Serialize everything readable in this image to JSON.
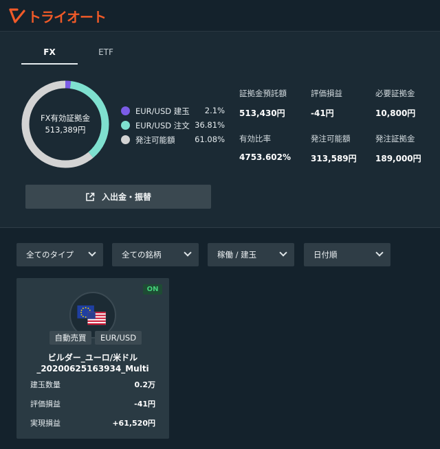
{
  "app": {
    "logo_text": "トライオート"
  },
  "tabs": [
    {
      "label": "FX",
      "active": true
    },
    {
      "label": "ETF",
      "active": false
    }
  ],
  "donut": {
    "center_title": "FX有効証拠金",
    "center_value": "513,389円",
    "segments": [
      {
        "name": "EUR/USD 建玉",
        "pct_label": "2.1%",
        "value": 2.1,
        "color": "#7b5ce6"
      },
      {
        "name": "EUR/USD 注文",
        "pct_label": "36.81%",
        "value": 36.81,
        "color": "#7fe0cf"
      },
      {
        "name": "発注可能額",
        "pct_label": "61.08%",
        "value": 61.08,
        "color": "#d3d3d3"
      }
    ]
  },
  "stats": [
    {
      "label": "証拠金預託額",
      "value": "513,430円"
    },
    {
      "label": "評価損益",
      "value": "-41円"
    },
    {
      "label": "必要証拠金",
      "value": "10,800円"
    },
    {
      "label": "有効比率",
      "value": "4753.602%"
    },
    {
      "label": "発注可能額",
      "value": "313,589円"
    },
    {
      "label": "発注証拠金",
      "value": "189,000円"
    }
  ],
  "deposit_button": {
    "label": "入出金・振替"
  },
  "filters": [
    {
      "label": "全てのタイプ"
    },
    {
      "label": "全ての銘柄"
    },
    {
      "label": "稼働 / 建玉"
    },
    {
      "label": "日付順"
    }
  ],
  "card": {
    "status": "ON",
    "status_color": "#44d07a",
    "tags": [
      "自動売買",
      "EUR/USD"
    ],
    "title_line1": "ビルダー_ユーロ/米ドル",
    "title_line2": "_20200625163934_Multi",
    "rows": [
      {
        "key": "建玉数量",
        "value": "0.2万"
      },
      {
        "key": "評価損益",
        "value": "-41円"
      },
      {
        "key": "実現損益",
        "value": "+61,520円"
      }
    ]
  },
  "colors": {
    "accent": "#f05a28",
    "background": "#14222c",
    "panel": "#1b2a34"
  }
}
